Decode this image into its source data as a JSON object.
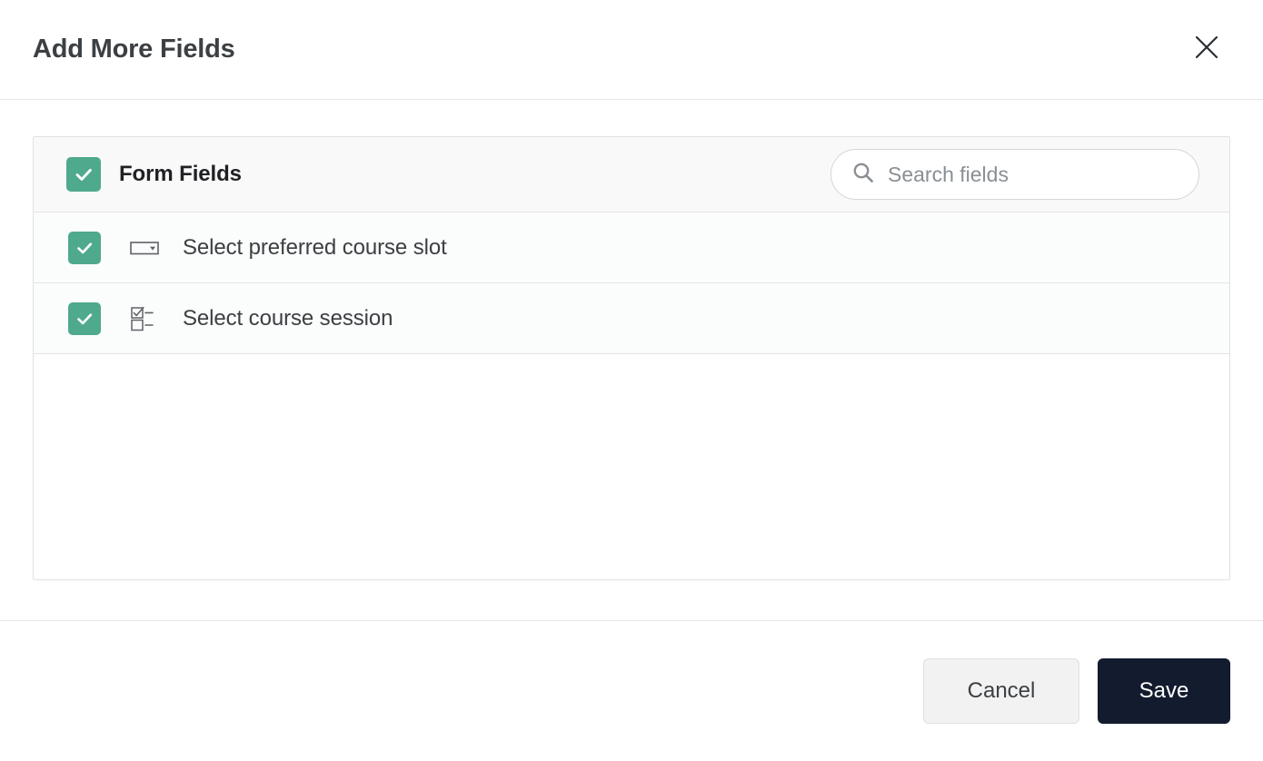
{
  "dialog": {
    "title": "Add More Fields",
    "close_icon": "close-icon"
  },
  "panel": {
    "group_label": "Form Fields",
    "group_checked": true,
    "search": {
      "placeholder": "Search fields",
      "value": "",
      "icon": "search-icon"
    },
    "rows": [
      {
        "label": "Select preferred course slot",
        "icon": "dropdown-field-icon",
        "checked": true
      },
      {
        "label": "Select course session",
        "icon": "checkbox-list-field-icon",
        "checked": true
      }
    ]
  },
  "footer": {
    "cancel_label": "Cancel",
    "save_label": "Save"
  },
  "colors": {
    "checkbox_green": "#4fa98d",
    "save_dark": "#131c2e",
    "cancel_gray": "#f2f2f2",
    "panel_header_gray": "#f9f9f9",
    "row_tint": "#fbfdfc",
    "border": "#e4e4e4",
    "text": "#3c4043",
    "placeholder": "#8a8f94"
  }
}
